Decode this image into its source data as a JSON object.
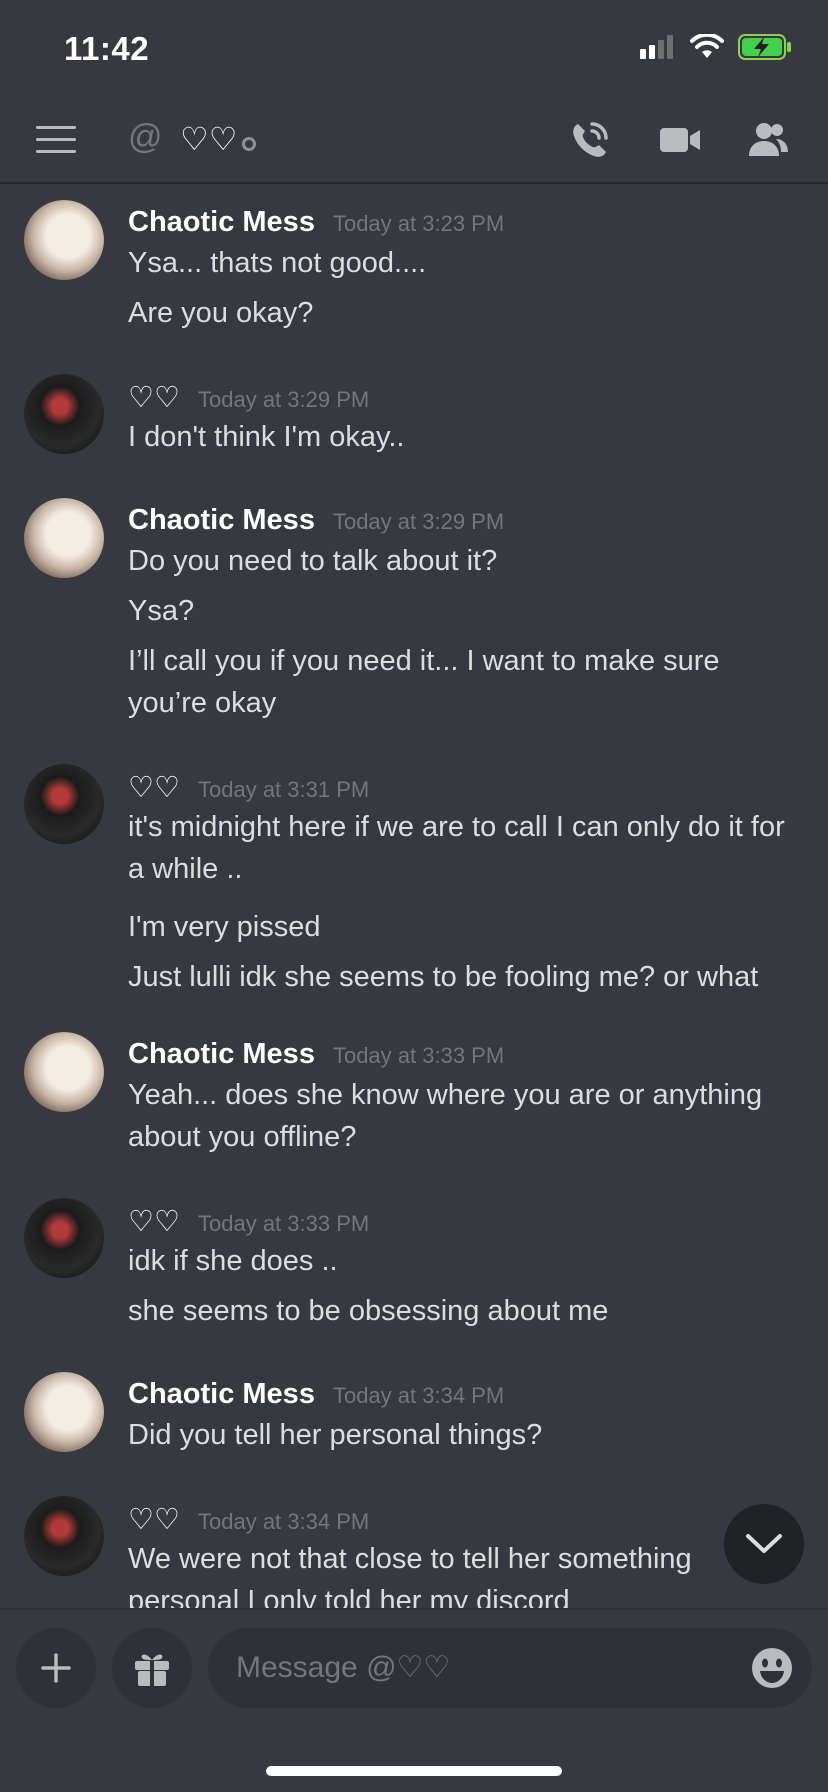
{
  "status_bar": {
    "time": "11:42",
    "icons": [
      "cellular-icon",
      "wifi-icon",
      "battery-charging-icon"
    ]
  },
  "header": {
    "menu_icon": "hamburger-icon",
    "dm_icon": "@",
    "channel_name": "♡♡",
    "actions": [
      "call-icon",
      "video-icon",
      "members-icon"
    ]
  },
  "messages": [
    {
      "author": "Chaotic Mess",
      "time": "Today at 3:23 PM",
      "avatar": "light",
      "lines": [
        "Ysa... thats not good....",
        "Are you okay?"
      ]
    },
    {
      "author": "♡♡",
      "time": "Today at 3:29 PM",
      "avatar": "dark",
      "lines": [
        "I don't think I'm okay.."
      ]
    },
    {
      "author": "Chaotic Mess",
      "time": "Today at 3:29 PM",
      "avatar": "light",
      "lines": [
        "Do you need to talk about it?",
        "Ysa?",
        "I’ll call you if you need it... I want to make sure you’re okay"
      ]
    },
    {
      "author": "♡♡",
      "time": "Today at 3:31 PM",
      "avatar": "dark",
      "lines": [
        "it's midnight here if we are to call I can only do it for a while ..",
        "I'm very pissed",
        "Just lulli idk she seems to be fooling me? or what"
      ]
    },
    {
      "author": "Chaotic Mess",
      "time": "Today at 3:33 PM",
      "avatar": "light",
      "lines": [
        "Yeah... does she know where you are or anything about you offline?"
      ]
    },
    {
      "author": "♡♡",
      "time": "Today at 3:33 PM",
      "avatar": "dark",
      "lines": [
        "idk if she does ..",
        "she seems to be obsessing about me"
      ]
    },
    {
      "author": "Chaotic Mess",
      "time": "Today at 3:34 PM",
      "avatar": "light",
      "lines": [
        "Did you tell her personal things?"
      ]
    },
    {
      "author": "♡♡",
      "time": "Today at 3:34 PM",
      "avatar": "dark",
      "lines": [
        "We were not that close to tell her something personal I only told her my discord"
      ]
    }
  ],
  "composer": {
    "add_icon": "plus-icon",
    "gift_icon": "gift-icon",
    "placeholder": "Message @♡♡",
    "emoji_icon": "emoji-icon"
  },
  "scroll_button_icon": "chevron-down-icon"
}
